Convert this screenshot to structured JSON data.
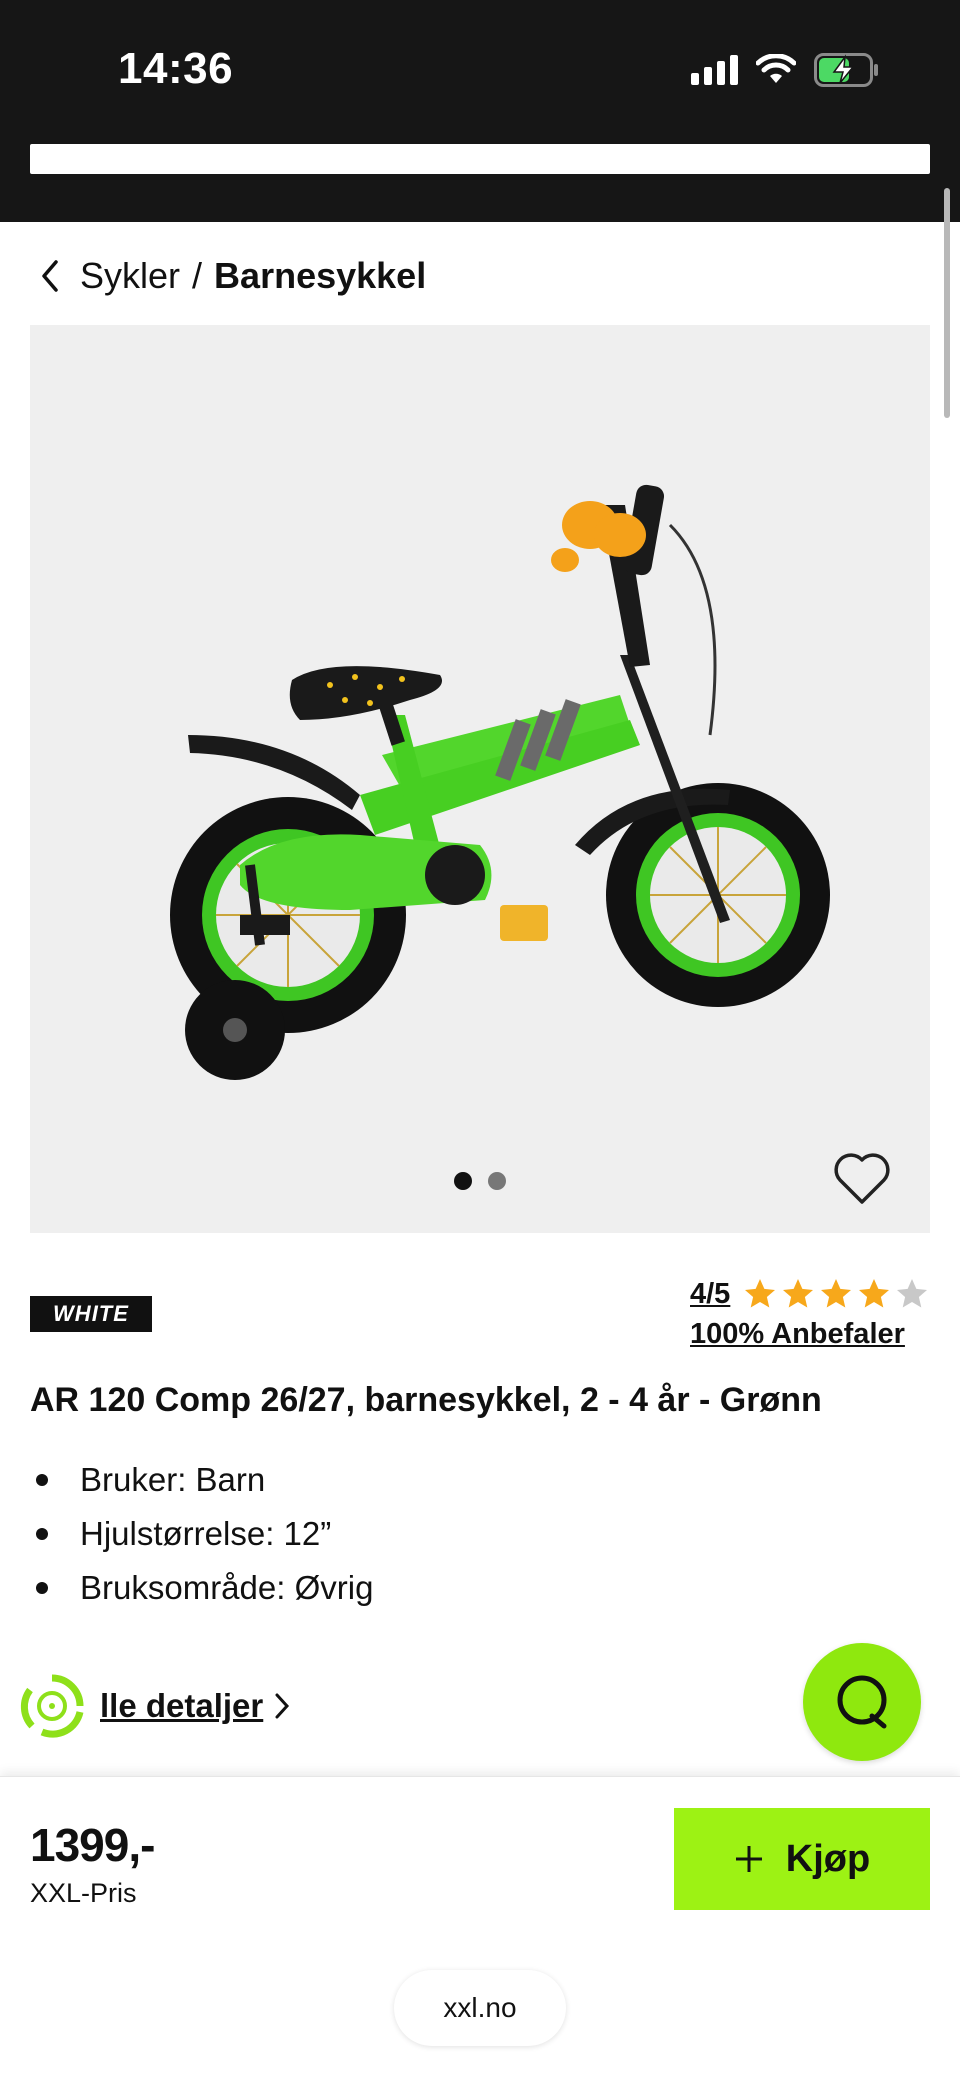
{
  "status_bar": {
    "time": "14:36",
    "icons": [
      "signal-icon",
      "wifi-icon",
      "battery-charging-icon"
    ],
    "battery_color": "#4cd964"
  },
  "breadcrumb": {
    "parent": "Sykler",
    "separator": "/",
    "current": "Barnesykkel"
  },
  "gallery": {
    "image_count": 2,
    "active_index": 0
  },
  "product": {
    "brand": "WHITE",
    "rating_text": "4/5",
    "rating_value": 4,
    "rating_max": 5,
    "recommend_text": "100% Anbefaler",
    "title": "AR 120 Comp 26/27, barnesykkel, 2 - 4 år - Grønn",
    "specs": [
      "Bruker: Barn",
      "Hjulstørrelse: 12”",
      "Bruksområde: Øvrig"
    ],
    "details_link": "lle detaljer"
  },
  "purchase": {
    "price": "1399,-",
    "price_label": "XXL-Pris",
    "buy_label": "Kjøp"
  },
  "browser": {
    "url": "xxl.no"
  },
  "colors": {
    "accent": "#9df214",
    "star": "#f7a81b",
    "star_empty": "#c8c8c8",
    "status_bg": "#161616"
  }
}
